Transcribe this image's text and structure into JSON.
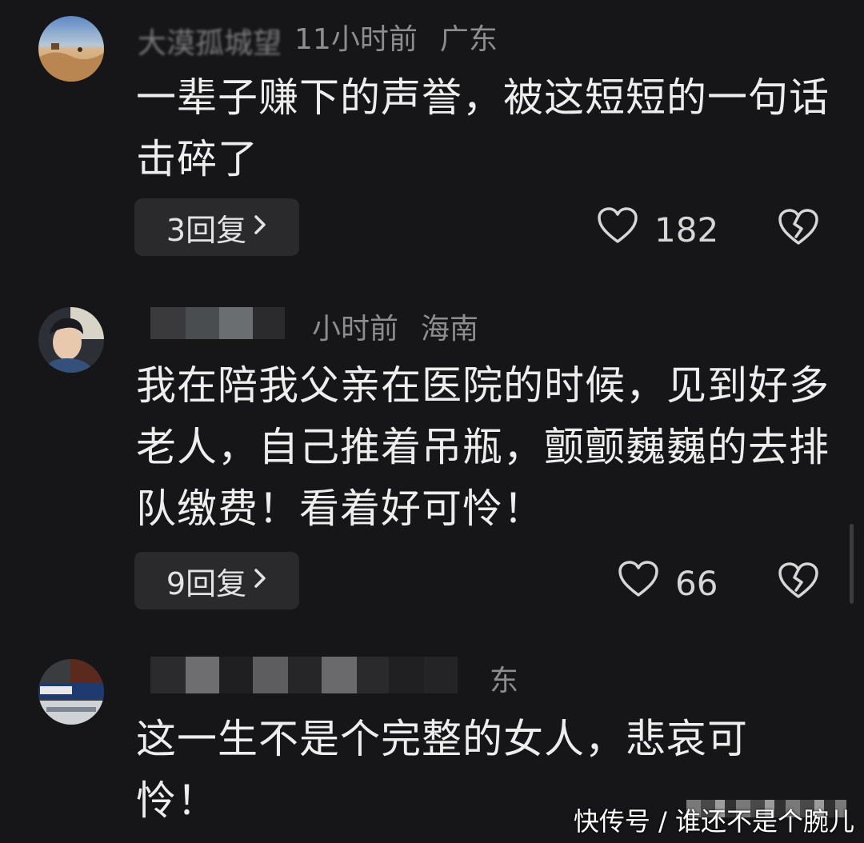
{
  "comments": [
    {
      "username": "大漠孤城望",
      "time": "11小时前",
      "location": "广东",
      "text": "一辈子赚下的声誉，被这短短的一句话击碎了",
      "reply_count": "3回复",
      "likes": "182"
    },
    {
      "username": "",
      "time": "小时前",
      "location": "海南",
      "text": "我在陪我父亲在医院的时候，见到好多老人，自己推着吊瓶，颤颤巍巍的去排队缴费！看着好可怜！",
      "reply_count": "9回复",
      "likes": "66"
    },
    {
      "username": "",
      "time": "",
      "location": "东",
      "text": "这一生不是个完整的女人，悲哀可怜！",
      "reply_count": "",
      "likes": ""
    }
  ],
  "icons": {
    "reply_chevron": "chevron-right-icon",
    "like": "heart-outline-icon",
    "dislike": "broken-heart-icon"
  },
  "watermark": "快传号 / 谁还不是个腕儿",
  "colors": {
    "background": "#161618",
    "text": "#ededed",
    "meta": "#8d8d91",
    "reply_button": "#2a2a2d"
  }
}
